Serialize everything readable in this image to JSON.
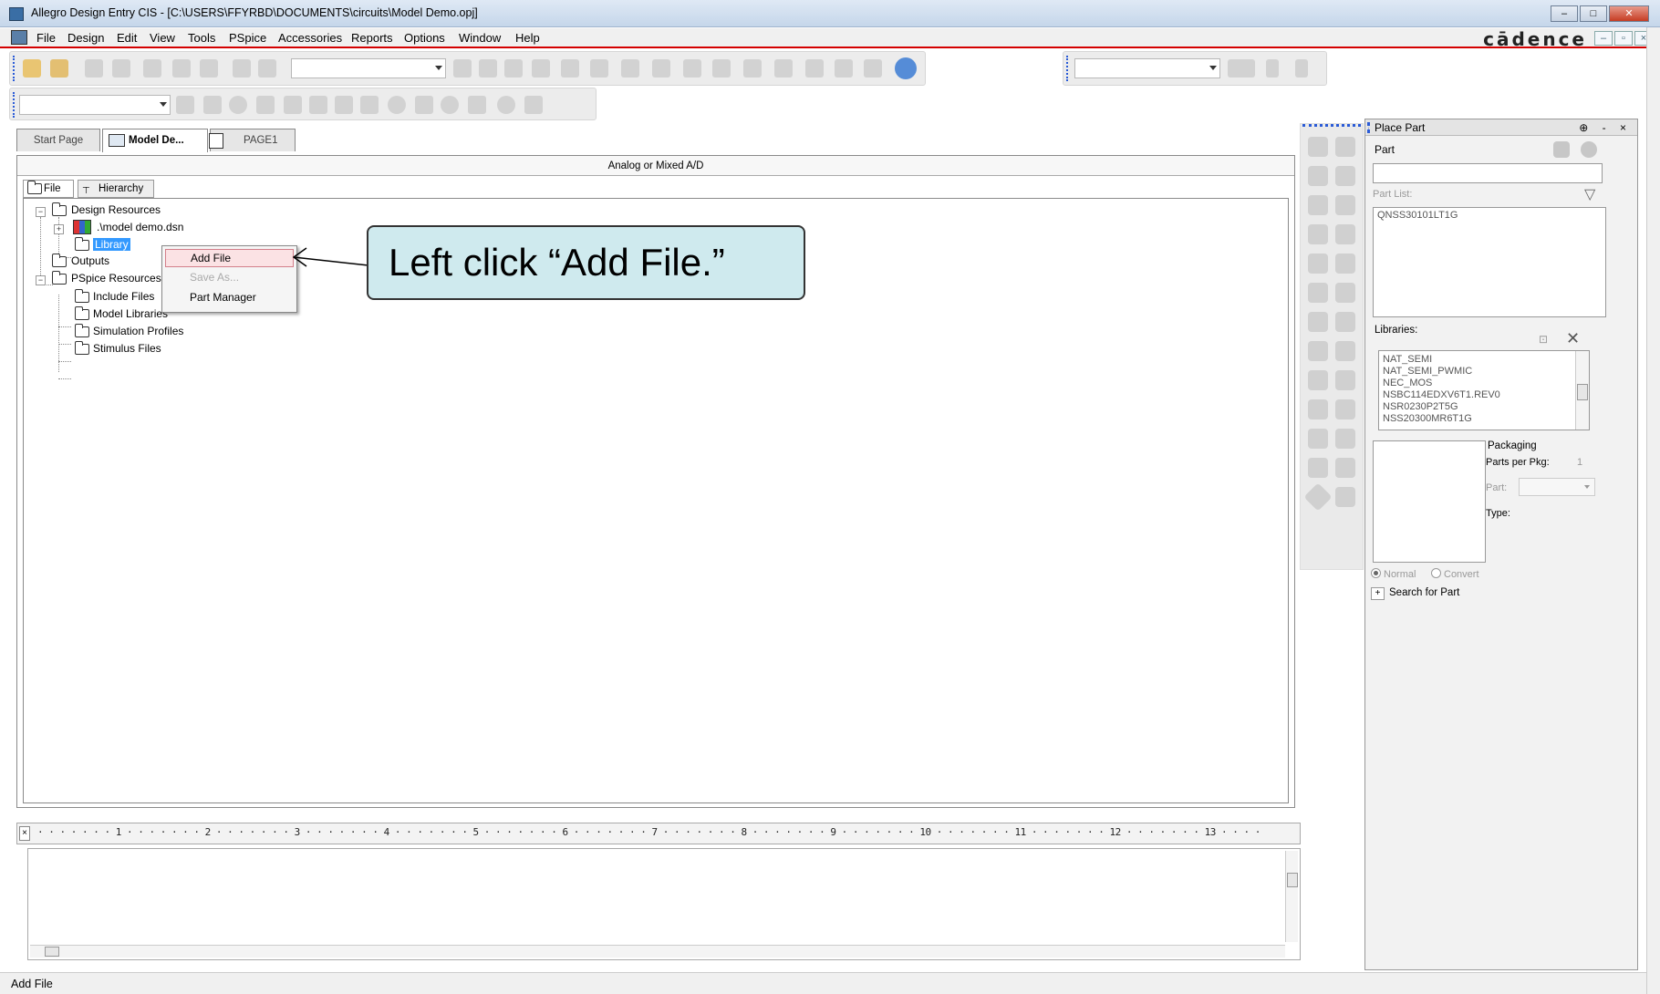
{
  "window": {
    "title": "Allegro Design Entry CIS - [C:\\USERS\\FFYRBD\\DOCUMENTS\\circuits\\Model Demo.opj]",
    "brand": "cādence"
  },
  "menu": [
    "File",
    "Design",
    "Edit",
    "View",
    "Tools",
    "PSpice",
    "Accessories",
    "Reports",
    "Options",
    "Window",
    "Help"
  ],
  "tabs": {
    "start": "Start Page",
    "model": "Model De...",
    "page1": "PAGE1"
  },
  "main": {
    "header": "Analog or Mixed A/D",
    "subtabs": {
      "file": "File",
      "hierarchy": "Hierarchy"
    }
  },
  "tree": {
    "design_resources": "Design Resources",
    "dsn": ".\\model demo.dsn",
    "library": "Library",
    "outputs": "Outputs",
    "pspice_resources": "PSpice Resources",
    "include_files": "Include Files",
    "model_libraries": "Model Libraries",
    "simulation_profiles": "Simulation Profiles",
    "stimulus_files": "Stimulus Files"
  },
  "context_menu": {
    "add_file": "Add File",
    "save_as": "Save As...",
    "part_manager": "Part Manager"
  },
  "callout": "Left click “Add File.”",
  "ruler": "· · · · · · · 1 · · · · · · · 2 · · · · · · · 3 · · · · · · · 4 · · · · · · · 5 · · · · · · · 6 · · · · · · · 7 · · · · · · · 8 · · · · · · · 9 · · · · · · · 10 · · · · · · · 11 · · · · · · · 12 · · · · · · · 13 · · · ·",
  "status": "Add File",
  "place_part": {
    "title": "Place Part",
    "part_label": "Part",
    "part_value": "",
    "part_list_label": "Part List:",
    "part_list": [
      "QNSS30101LT1G"
    ],
    "libraries_label": "Libraries:",
    "libraries": [
      "NAT_SEMI",
      "NAT_SEMI_PWMIC",
      "NEC_MOS",
      "NSBC114EDXV6T1.REV0",
      "NSR0230P2T5G",
      "NSS20300MR6T1G"
    ],
    "packaging_label": "Packaging",
    "parts_per_pkg_label": "Parts per Pkg:",
    "parts_per_pkg_value": "1",
    "part_field_label": "Part:",
    "type_label": "Type:",
    "normal_label": "Normal",
    "convert_label": "Convert",
    "search_label": "Search for Part"
  }
}
